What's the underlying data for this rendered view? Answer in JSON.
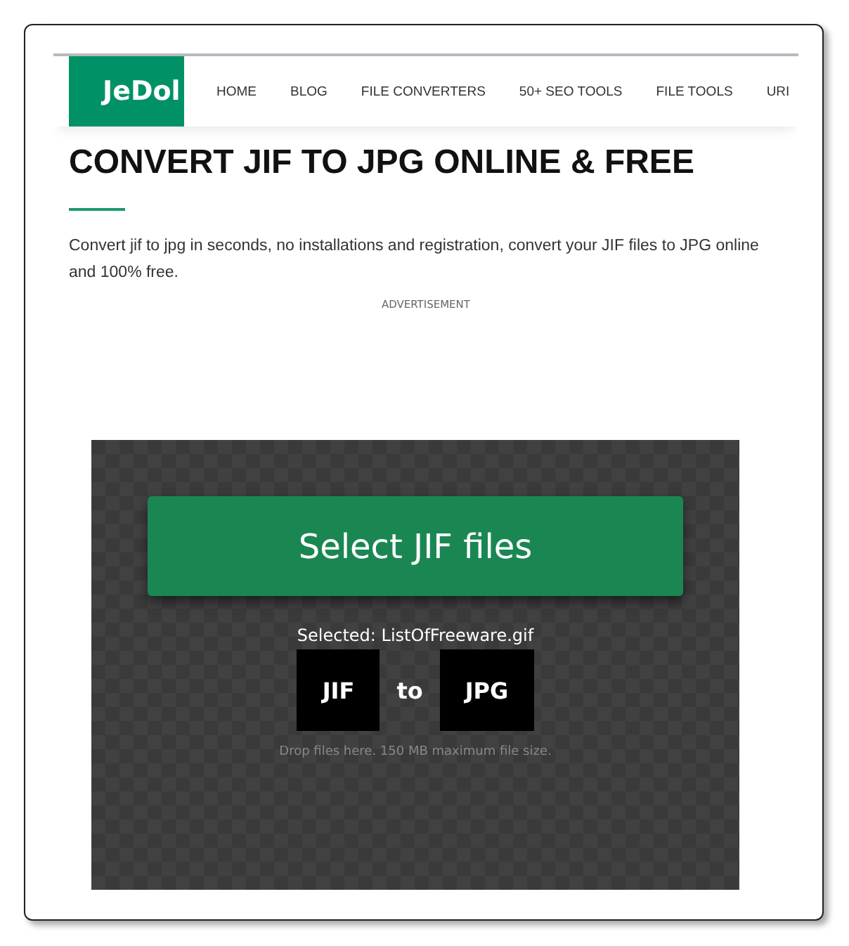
{
  "logo": "JeDol",
  "nav": [
    "HOME",
    "BLOG",
    "FILE CONVERTERS",
    "50+ SEO TOOLS",
    "FILE TOOLS",
    "URI"
  ],
  "title": "CONVERT JIF TO JPG ONLINE & FREE",
  "intro": "Convert jif to jpg in seconds, no installations and registration, convert your JIF files to JPG online and 100% free.",
  "ad_label": "ADVERTISEMENT",
  "converter": {
    "button": "Select JIF files",
    "selected": "Selected: ListOfFreeware.gif",
    "from": "JIF",
    "joiner": "to",
    "to": "JPG",
    "hint": "Drop files here. 150 MB maximum file size."
  }
}
